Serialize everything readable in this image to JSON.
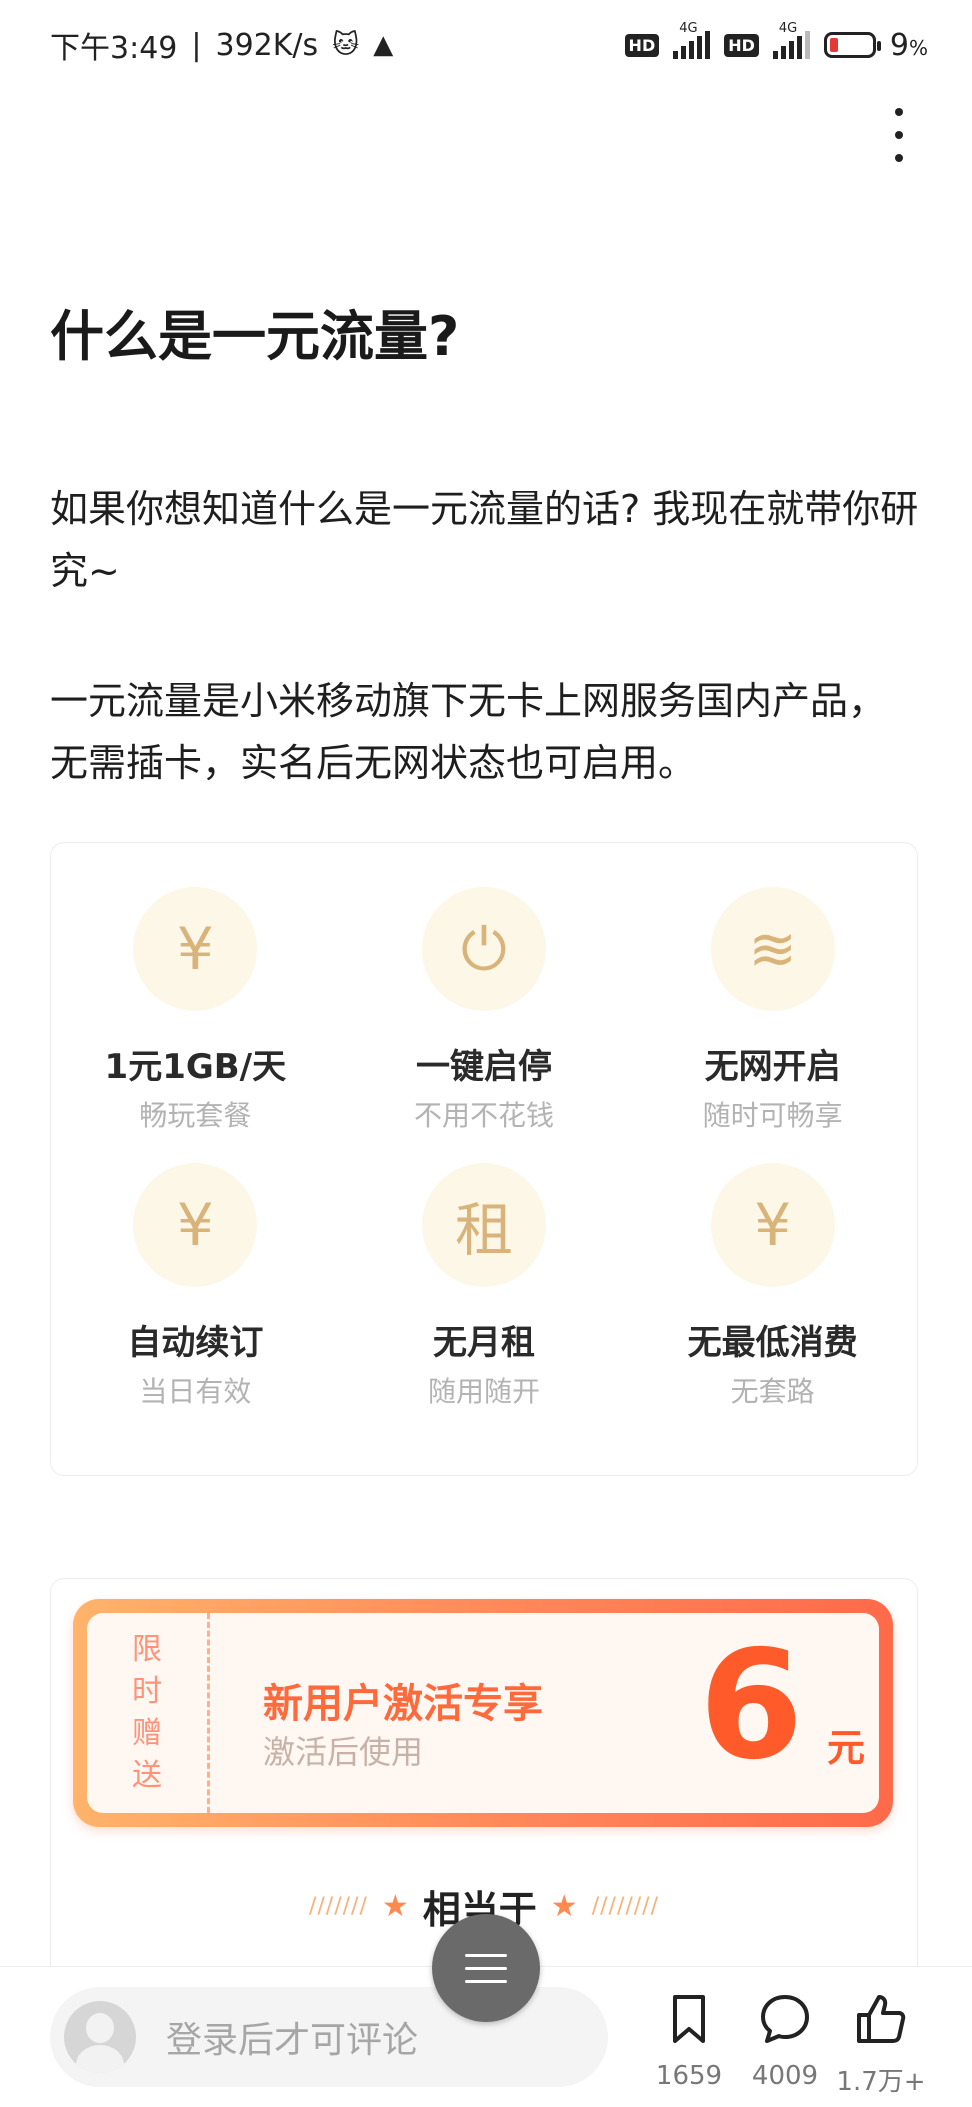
{
  "status_bar": {
    "time": "下午3:49",
    "speed": "392K/s",
    "network_type": "4G",
    "hd_label": "HD",
    "battery": "9",
    "battery_unit": "%"
  },
  "article": {
    "title": "什么是一元流量?",
    "paragraph1": "如果你想知道什么是一元流量的话? 我现在就带你研究~",
    "paragraph2": "一元流量是小米移动旗下无卡上网服务国内产品，无需插卡，实名后无网状态也可启用。"
  },
  "features": [
    {
      "icon": "yen-circle-icon",
      "glyph": "¥",
      "title": "1元1GB/天",
      "sub": "畅玩套餐"
    },
    {
      "icon": "power-icon",
      "glyph": "⏻",
      "title": "一键启停",
      "sub": "不用不花钱"
    },
    {
      "icon": "wifi-off-icon",
      "glyph": "≋",
      "title": "无网开启",
      "sub": "随时可畅享"
    },
    {
      "icon": "renew-icon",
      "glyph": "¥",
      "title": "自动续订",
      "sub": "当日有效"
    },
    {
      "icon": "no-rent-icon",
      "glyph": "租",
      "title": "无月租",
      "sub": "随用随开"
    },
    {
      "icon": "no-minimum-icon",
      "glyph": "¥",
      "title": "无最低消费",
      "sub": "无套路"
    }
  ],
  "coupon": {
    "side_text": "限时赠送",
    "title": "新用户激活专享",
    "subtitle": "激活后使用",
    "amount": "6",
    "unit": "元",
    "equivalent_label": "相当于"
  },
  "bottom_bar": {
    "comment_placeholder": "登录后才可评论",
    "favorites_count": "1659",
    "comments_count": "4009",
    "likes_count": "1.7万+"
  }
}
